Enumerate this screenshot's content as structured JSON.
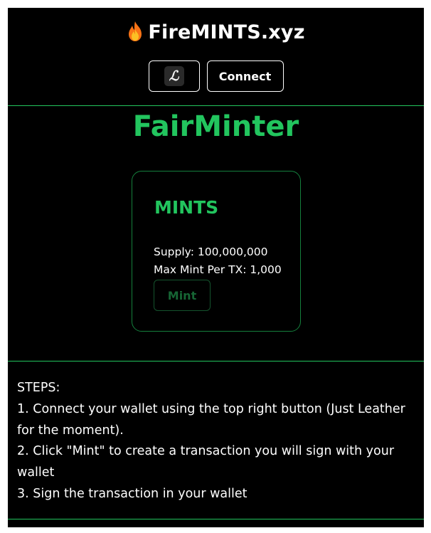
{
  "header": {
    "brand_icon": "flame-icon",
    "brand_name": "FireMINTS.xyz",
    "wallet_icon_glyph": "ℒ",
    "wallet_icon": "leather-wallet-icon",
    "connect_label": "Connect"
  },
  "main": {
    "title": "FairMinter",
    "card": {
      "token": "MINTS",
      "supply_line": "Supply: 100,000,000",
      "max_mint_line": "Max Mint Per TX: 1,000",
      "mint_label": "Mint"
    }
  },
  "steps": {
    "heading": "STEPS:",
    "items": [
      "1. Connect your wallet using the top right button (Just Leather for the moment).",
      "2. Click \"Mint\" to create a transaction you will sign with your wallet",
      "3. Sign the transaction in your wallet"
    ]
  },
  "colors": {
    "accent": "#22c55e",
    "background": "#000000",
    "text": "#ffffff",
    "disabled": "#166534"
  }
}
